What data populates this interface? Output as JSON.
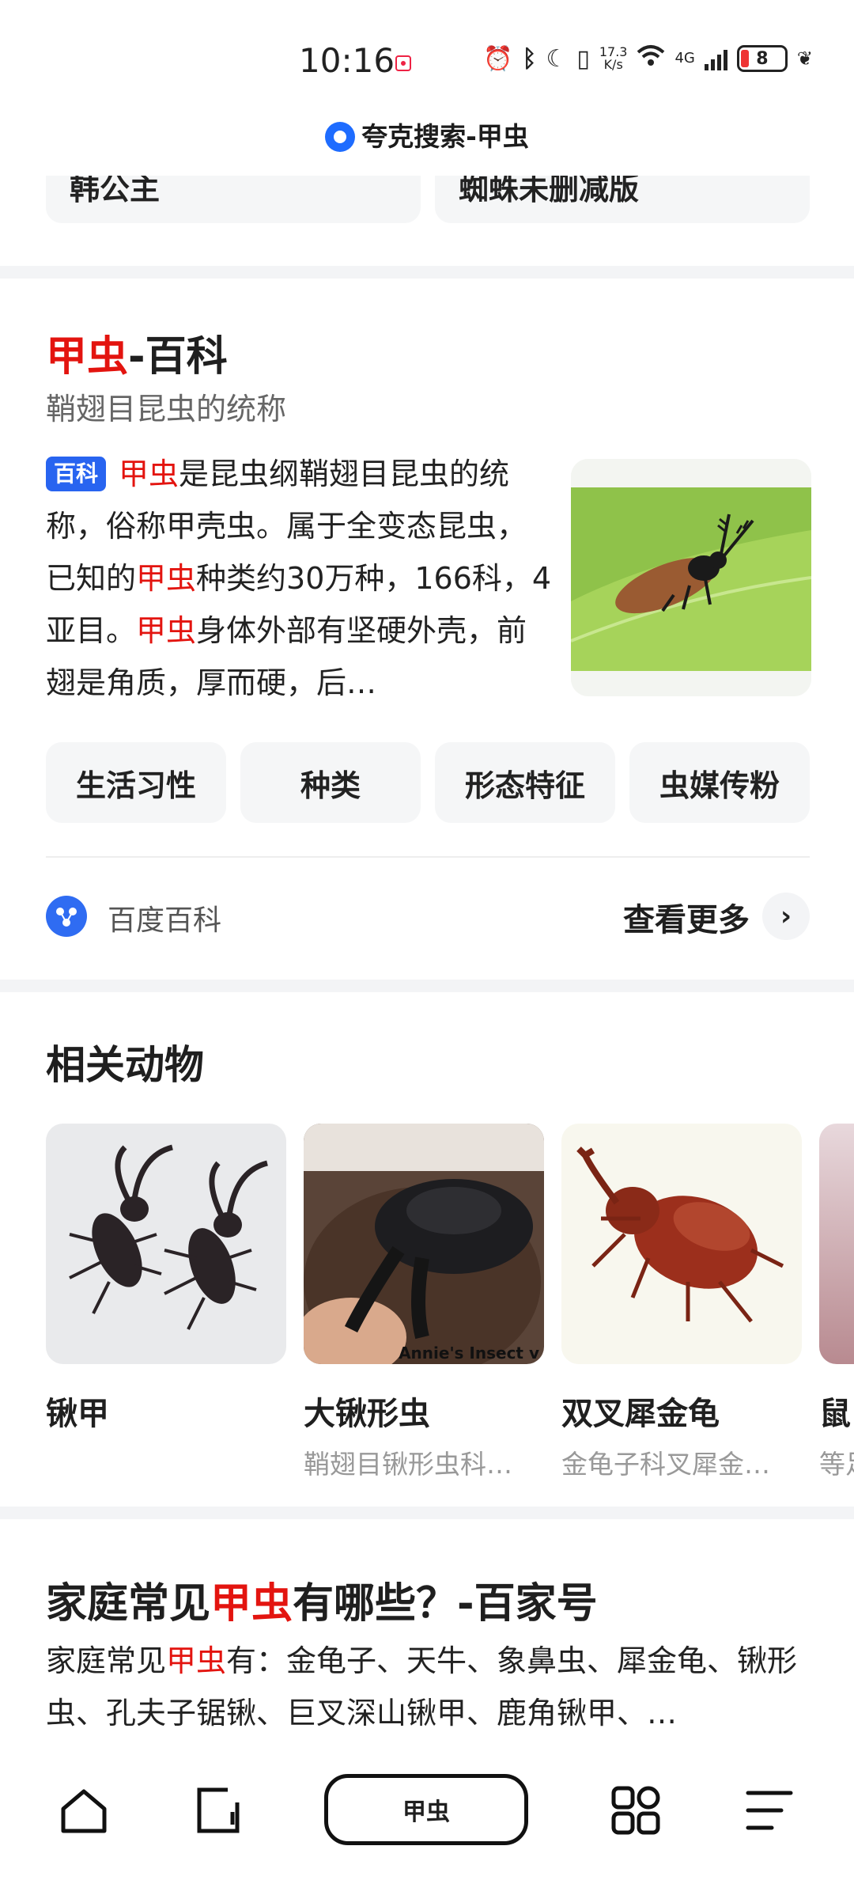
{
  "status_bar": {
    "time": "10:16",
    "net_speed_top": "17.3",
    "net_speed_bottom": "K/s",
    "network": "4G",
    "battery": "8"
  },
  "header": {
    "title": "夸克搜索-甲虫"
  },
  "top_cards": {
    "left": "韩公主",
    "right": "蜘蛛未删减版"
  },
  "wiki": {
    "title_highlight": "甲虫",
    "title_rest": "-百科",
    "subtitle": "鞘翅目昆虫的统称",
    "badge": "百科",
    "body": [
      {
        "t": "甲虫",
        "hl": true
      },
      {
        "t": "是昆虫纲鞘翅目昆虫的统称，俗称甲壳虫。属于全变态昆虫，已知的",
        "hl": false
      },
      {
        "t": "甲虫",
        "hl": true
      },
      {
        "t": "种类约30万种，166科，4亚目。",
        "hl": false
      },
      {
        "t": "甲虫",
        "hl": true
      },
      {
        "t": "身体外部有坚硬外壳，前翅是角质，厚而硬，后…",
        "hl": false
      }
    ],
    "chips": [
      "生活习性",
      "种类",
      "形态特征",
      "虫媒传粉"
    ],
    "source": "百度百科",
    "more": "查看更多"
  },
  "related": {
    "title": "相关动物",
    "items": [
      {
        "name": "锹甲",
        "desc": ""
      },
      {
        "name": "大锹形虫",
        "desc": "鞘翅目锹形虫科…",
        "watermark": "Annie's Insect v"
      },
      {
        "name": "双叉犀金龟",
        "desc": "金龟子科叉犀金…"
      },
      {
        "name": "鼠",
        "desc": "等足"
      }
    ]
  },
  "article": {
    "title_pre": "家庭常见",
    "title_hl": "甲虫",
    "title_post": "有哪些？-百家号",
    "body_pre": "家庭常见",
    "body_hl": "甲虫",
    "body_post": "有：金龟子、天牛、象鼻虫、犀金龟、锹形虫、孔夫子锯锹、巨叉深山锹甲、鹿角锹甲、…"
  },
  "bottom_nav": {
    "search_label": "甲虫",
    "icons": [
      "home-icon",
      "tabs-icon",
      "apps-icon",
      "menu-icon"
    ]
  }
}
